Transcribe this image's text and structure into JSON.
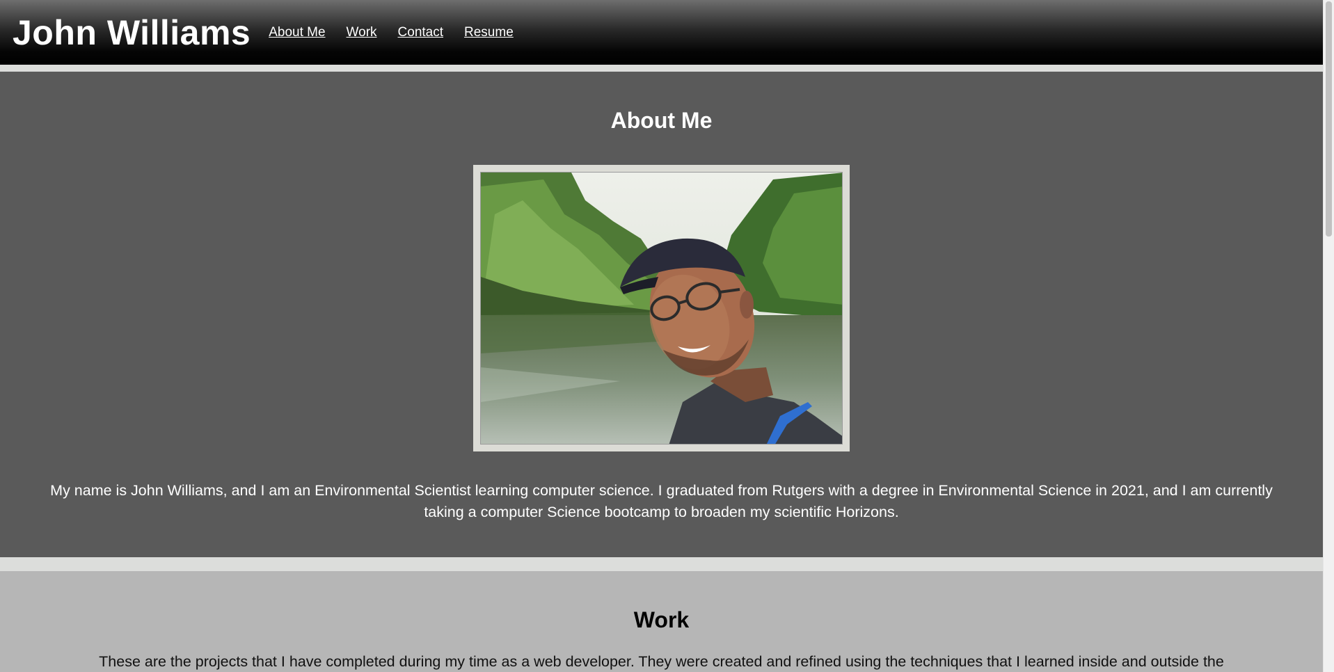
{
  "header": {
    "title": "John Williams",
    "nav": [
      {
        "label": "About Me"
      },
      {
        "label": "Work"
      },
      {
        "label": "Contact"
      },
      {
        "label": "Resume"
      }
    ]
  },
  "about": {
    "heading": "About Me",
    "photo_icon": "profile-photo",
    "text": "My name is John Williams, and I am an Environmental Scientist learning computer science. I graduated from Rutgers with a degree in Environmental Science in 2021, and I am currently taking a computer Science bootcamp to broaden my scientific Horizons."
  },
  "work": {
    "heading": "Work",
    "text": "These are the projects that I have completed during my time as a web developer. They were created and refined using the techniques that I learned inside and outside the"
  },
  "colors": {
    "header_top": "#6e6e6e",
    "header_bottom": "#000000",
    "about_bg": "#5a5a5a",
    "work_bg": "#b6b6b6",
    "divider": "#dcdddb"
  }
}
